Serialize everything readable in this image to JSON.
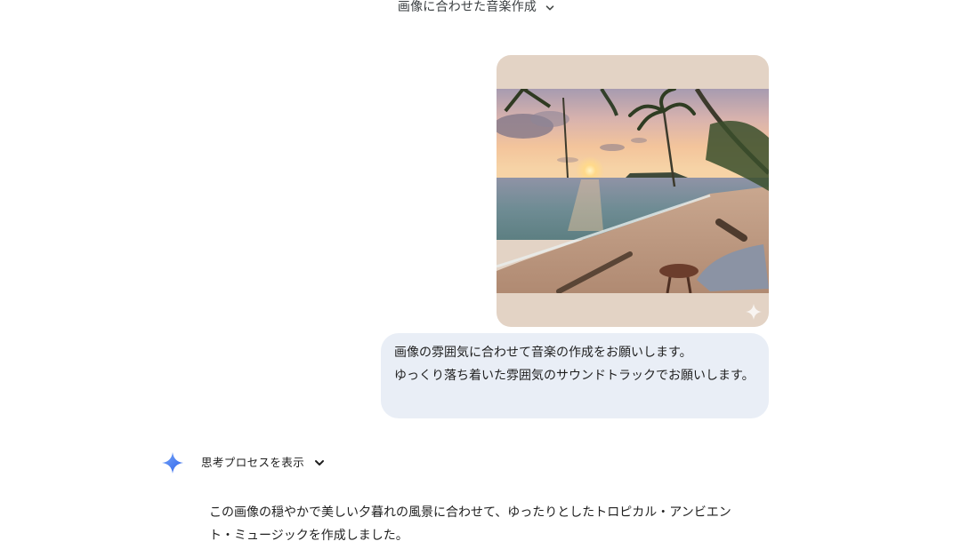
{
  "header": {
    "conversation_title": "画像に合わせた音楽作成"
  },
  "user_message": {
    "text": "画像の雰囲気に合わせて音楽の作成をお願いします。\nゆっくり落ち着いた雰囲気のサウンドトラックでお願いします。",
    "image_alt": "sunset beach with palm trees"
  },
  "assistant": {
    "thinking_toggle_label": "思考プロセスを表示",
    "response_text": "この画像の穏やかで美しい夕暮れの風景に合わせて、ゆったりとしたトロピカル・アンビエント・ミュージックを作成しました。"
  },
  "icons": {
    "title_chevron": "chevron-down-icon",
    "thinking_chevron": "chevron-down-icon",
    "assistant_avatar": "gemini-sparkle-icon",
    "image_watermark": "sparkle-icon"
  },
  "colors": {
    "user_bubble": "#e9eef6",
    "image_card_bg": "#e3d3c5",
    "gemini_blue": "#4a7df1"
  }
}
